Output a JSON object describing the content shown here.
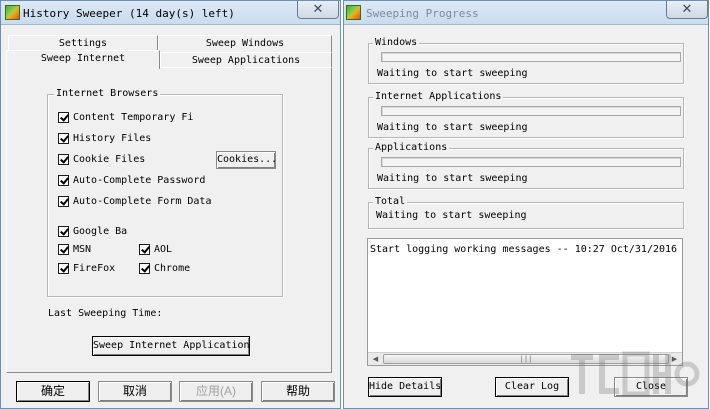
{
  "left_window": {
    "title": "History Sweeper (14 day(s) left)",
    "close_glyph": "✕",
    "tabs": [
      "Settings",
      "Sweep Windows",
      "Sweep Internet",
      "Sweep Applications"
    ],
    "active_tab": "Sweep Internet",
    "group_title": "Internet Browsers",
    "checkboxes": {
      "content_temp": "Content Temporary Fi",
      "history_files": "History Files",
      "cookie_files": "Cookie Files",
      "autocomplete_password": "Auto-Complete Password",
      "autocomplete_form": "Auto-Complete Form Data",
      "google_bar": "Google Ba",
      "msn": "MSN",
      "aol": "AOL",
      "firefox": "FireFox",
      "chrome": "Chrome"
    },
    "cookies_button": "Cookies...",
    "last_sweeping_label": "Last Sweeping Time:",
    "sweep_button": "Sweep Internet Applications",
    "bottom_buttons": {
      "ok": "确定",
      "cancel": "取消",
      "apply": "应用(A)",
      "help": "帮助"
    }
  },
  "right_window": {
    "title": "Sweeping Progress",
    "close_glyph": "✕",
    "groups": [
      {
        "title": "Windows",
        "status": "Waiting to start sweeping"
      },
      {
        "title": "Internet Applications",
        "status": "Waiting to start sweeping"
      },
      {
        "title": "Applications",
        "status": "Waiting to start sweeping"
      },
      {
        "title": "Total",
        "status": "Waiting to start sweeping"
      }
    ],
    "log_text": "Start logging working messages  -- 10:27 Oct/31/2016",
    "scroll": {
      "left": "◀",
      "right": "▶",
      "grip": "|||"
    },
    "buttons": {
      "hide_details": "Hide Details",
      "clear_log": "Clear Log",
      "close": "Close"
    }
  }
}
